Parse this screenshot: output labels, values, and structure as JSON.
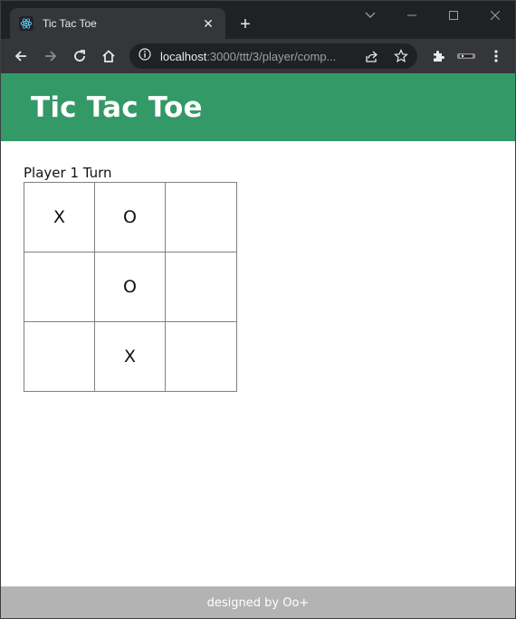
{
  "browser": {
    "tab_title": "Tic Tac Toe",
    "tab_close": "✕",
    "new_tab": "+",
    "url_host": "localhost",
    "url_rest": ":3000/ttt/3/player/comp..."
  },
  "app": {
    "title": "Tic Tac Toe",
    "accent_color": "#339966",
    "turn_text": "Player 1 Turn"
  },
  "board": {
    "cells": [
      [
        "X",
        "O",
        ""
      ],
      [
        "",
        "O",
        ""
      ],
      [
        "",
        "X",
        ""
      ]
    ]
  },
  "footer": {
    "text": "designed by Oo+",
    "color": "#b3b3b3"
  }
}
